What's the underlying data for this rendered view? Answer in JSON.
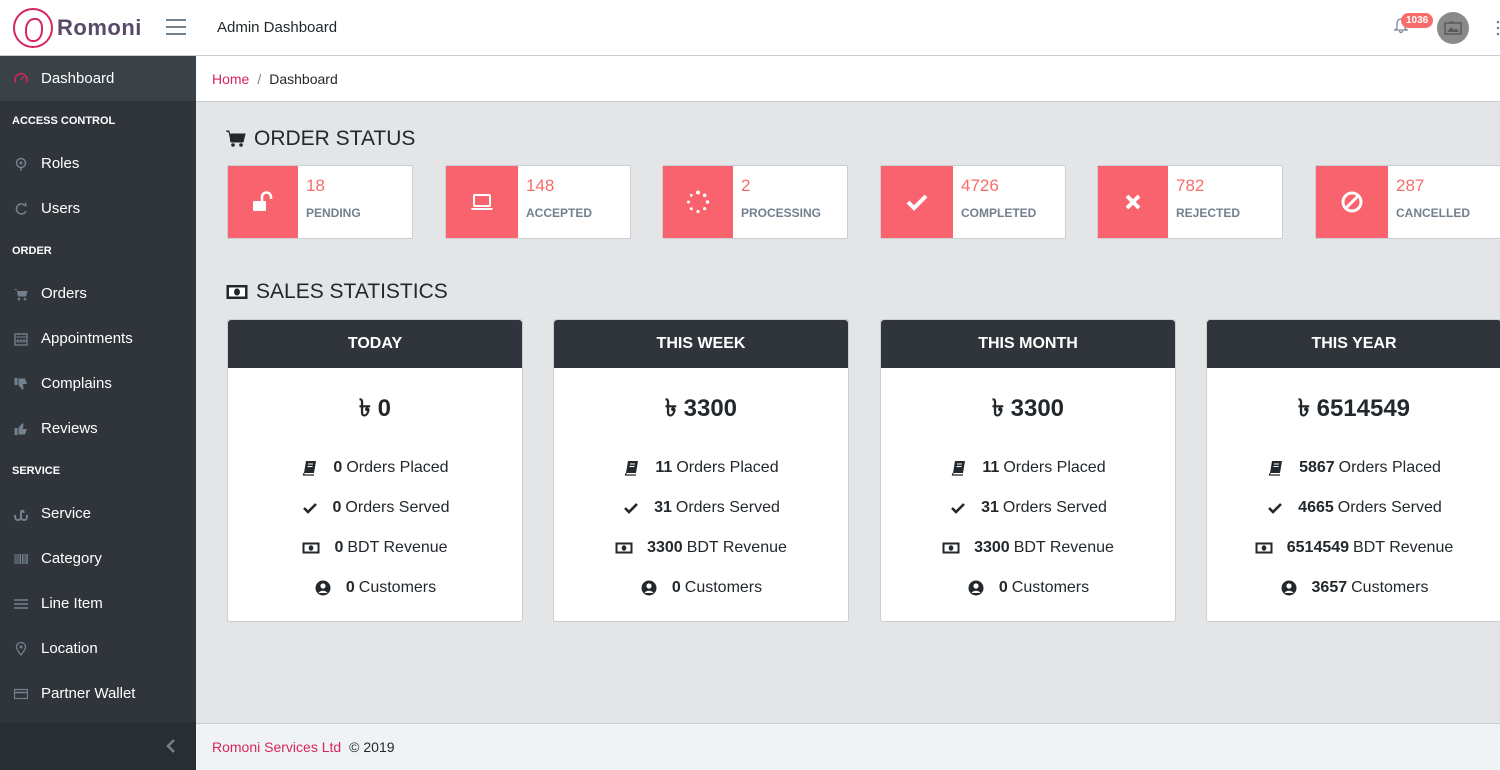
{
  "header": {
    "brand": "Romoni",
    "title": "Admin Dashboard",
    "notification_count": "1036"
  },
  "sidebar": {
    "items": [
      {
        "type": "item",
        "label": "Dashboard",
        "icon": "speedometer-icon",
        "active": true
      },
      {
        "type": "title",
        "label": "ACCESS CONTROL"
      },
      {
        "type": "item",
        "label": "Roles",
        "icon": "map-pin-icon"
      },
      {
        "type": "item",
        "label": "Users",
        "icon": "refresh-icon"
      },
      {
        "type": "title",
        "label": "ORDER"
      },
      {
        "type": "item",
        "label": "Orders",
        "icon": "cart-icon"
      },
      {
        "type": "item",
        "label": "Appointments",
        "icon": "calendar-icon"
      },
      {
        "type": "item",
        "label": "Complains",
        "icon": "thumbs-down-icon"
      },
      {
        "type": "item",
        "label": "Reviews",
        "icon": "thumbs-up-icon"
      },
      {
        "type": "title",
        "label": "SERVICE"
      },
      {
        "type": "item",
        "label": "Service",
        "icon": "stumbleupon-icon"
      },
      {
        "type": "item",
        "label": "Category",
        "icon": "barcode-icon"
      },
      {
        "type": "item",
        "label": "Line Item",
        "icon": "list-icon"
      },
      {
        "type": "item",
        "label": "Location",
        "icon": "location-pin-icon"
      },
      {
        "type": "item",
        "label": "Partner Wallet",
        "icon": "credit-card-icon"
      }
    ]
  },
  "breadcrumb": {
    "home": "Home",
    "current": "Dashboard"
  },
  "order_status": {
    "title": "ORDER STATUS",
    "cards": [
      {
        "value": "18",
        "label": "PENDING",
        "icon": "unlock-icon"
      },
      {
        "value": "148",
        "label": "ACCEPTED",
        "icon": "laptop-icon"
      },
      {
        "value": "2",
        "label": "PROCESSING",
        "icon": "spinner-icon"
      },
      {
        "value": "4726",
        "label": "COMPLETED",
        "icon": "check-icon"
      },
      {
        "value": "782",
        "label": "REJECTED",
        "icon": "times-icon"
      },
      {
        "value": "287",
        "label": "CANCELLED",
        "icon": "ban-icon"
      }
    ]
  },
  "sales_statistics": {
    "title": "SALES STATISTICS",
    "currency_symbol": "৳",
    "cards": [
      {
        "period": "TODAY",
        "total": "0",
        "orders_placed": "0",
        "orders_served": "0",
        "revenue": "0",
        "customers": "0"
      },
      {
        "period": "THIS WEEK",
        "total": "3300",
        "orders_placed": "11",
        "orders_served": "31",
        "revenue": "3300",
        "customers": "0"
      },
      {
        "period": "THIS MONTH",
        "total": "3300",
        "orders_placed": "11",
        "orders_served": "31",
        "revenue": "3300",
        "customers": "0"
      },
      {
        "period": "THIS YEAR",
        "total": "6514549",
        "orders_placed": "5867",
        "orders_served": "4665",
        "revenue": "6514549",
        "customers": "3657"
      }
    ],
    "labels": {
      "orders_placed": "Orders Placed",
      "orders_served": "Orders Served",
      "revenue": "BDT Revenue",
      "customers": "Customers"
    }
  },
  "footer": {
    "company": "Romoni Services Ltd",
    "copyright": "© 2019"
  },
  "colors": {
    "accent": "#d6265c",
    "status_red": "#f8636d",
    "sidebar_bg": "#2f353a",
    "card_head": "#2f353a"
  }
}
